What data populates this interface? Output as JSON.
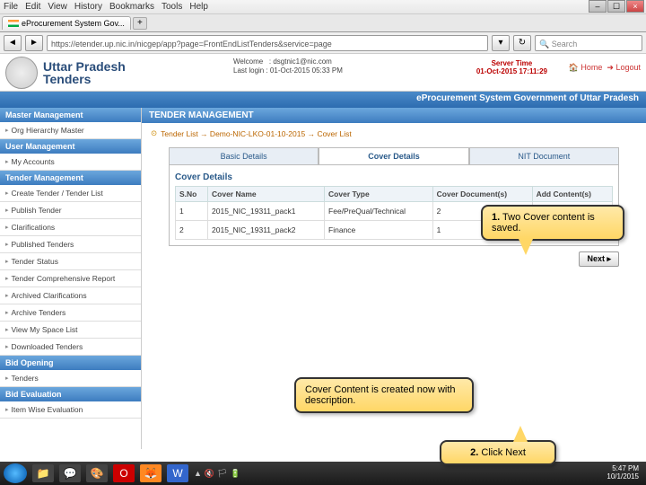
{
  "menubar": {
    "items": [
      "File",
      "Edit",
      "View",
      "History",
      "Bookmarks",
      "Tools",
      "Help"
    ]
  },
  "window": {
    "min": "–",
    "max": "☐",
    "close": "×"
  },
  "tab": {
    "title": "eProcurement System Gov...",
    "plus": "+"
  },
  "url": {
    "back": "◄",
    "fwd": "►",
    "value": "https://etender.up.nic.in/nicgep/app?page=FrontEndListTenders&service=page",
    "reload": "↻",
    "dropdown": "▾",
    "search_placeholder": "Search"
  },
  "site": {
    "title_line1": "Uttar Pradesh",
    "title_line2": "Tenders"
  },
  "usermeta": {
    "l1": "Welcome",
    "l2": "Last login",
    "v1": ": dsgtnic1@nic.com",
    "v2": ": 01-Oct-2015 05:33 PM"
  },
  "server": {
    "label": "Server Time",
    "value": "01-Oct-2015 17:11:29"
  },
  "toplinks": {
    "home": "🏠 Home",
    "logout": "➜ Logout"
  },
  "bluebar": {
    "text": "eProcurement System Government of Uttar Pradesh"
  },
  "sidebar": {
    "groups": [
      {
        "head": "Master Management",
        "items": [
          "Org Hierarchy Master"
        ]
      },
      {
        "head": "User Management",
        "items": [
          "My Accounts"
        ]
      },
      {
        "head": "Tender Management",
        "items": [
          "Create Tender / Tender List",
          "Publish Tender",
          "Clarifications",
          "Published Tenders",
          "Tender Status",
          "Tender Comprehensive Report",
          "Archived Clarifications",
          "Archive Tenders",
          "View My Space List",
          "Downloaded Tenders"
        ]
      },
      {
        "head": "Bid Opening",
        "items": [
          "Tenders"
        ]
      },
      {
        "head": "Bid Evaluation",
        "items": [
          "Item Wise Evaluation"
        ]
      }
    ]
  },
  "content": {
    "page_title": "TENDER MANAGEMENT",
    "breadcrumb": "Tender List → Demo-NIC-LKO-01-10-2015 → Cover List",
    "tabs": [
      "Basic Details",
      "Cover Details",
      "NIT Document"
    ],
    "active_tab": 1,
    "panel_head": "Cover Details",
    "columns": [
      "S.No",
      "Cover Name",
      "Cover Type",
      "Cover Document(s)",
      "Add Content(s)"
    ],
    "rows": [
      {
        "sno": "1",
        "name": "2015_NIC_19311_pack1",
        "type": "Fee/PreQual/Technical",
        "docs": "2",
        "icon": "📂"
      },
      {
        "sno": "2",
        "name": "2015_NIC_19311_pack2",
        "type": "Finance",
        "docs": "1",
        "icon": "📂"
      }
    ],
    "next_label": "Next ▸"
  },
  "callouts": {
    "c1_bold": "1.",
    "c1_text": " Two Cover content is saved.",
    "c2_text": "Cover Content is created now with description.",
    "c3_bold": "2.",
    "c3_text": " Click Next"
  },
  "taskbar": {
    "icons": [
      "📁",
      "💬",
      "🎨",
      "O",
      "🦊",
      "W"
    ],
    "tray": [
      "▲",
      "🔇",
      "🏳",
      "🔋"
    ],
    "time": "5:47 PM",
    "date": "10/1/2015"
  }
}
